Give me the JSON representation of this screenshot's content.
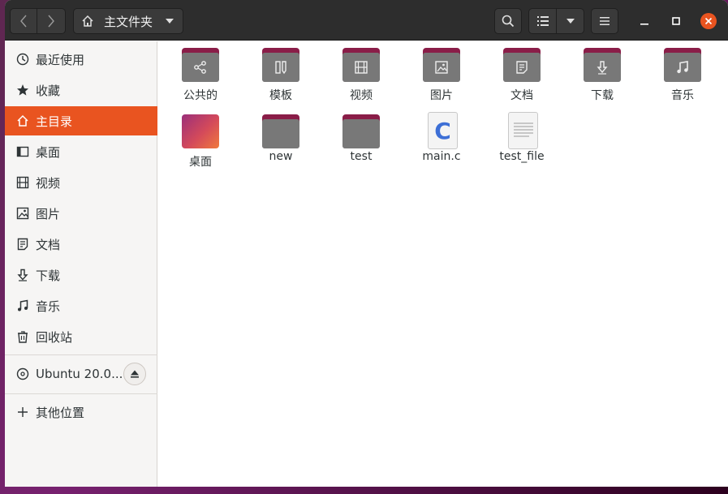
{
  "header": {
    "path_label": "主文件夹"
  },
  "sidebar": {
    "items": [
      {
        "label": "最近使用",
        "icon": "clock-icon"
      },
      {
        "label": "收藏",
        "icon": "star-icon"
      },
      {
        "label": "主目录",
        "icon": "home-icon",
        "active": true
      },
      {
        "label": "桌面",
        "icon": "desktop-icon"
      },
      {
        "label": "视频",
        "icon": "video-icon"
      },
      {
        "label": "图片",
        "icon": "picture-icon"
      },
      {
        "label": "文档",
        "icon": "document-icon"
      },
      {
        "label": "下载",
        "icon": "download-icon"
      },
      {
        "label": "音乐",
        "icon": "music-icon"
      },
      {
        "label": "回收站",
        "icon": "trash-icon"
      }
    ],
    "device": {
      "label": "Ubuntu 20.0...",
      "icon": "disc-icon"
    },
    "other": {
      "label": "其他位置",
      "icon": "plus-icon"
    }
  },
  "files": [
    {
      "label": "公共的",
      "kind": "folder",
      "icon": "share-icon"
    },
    {
      "label": "模板",
      "kind": "folder",
      "icon": "template-icon"
    },
    {
      "label": "视频",
      "kind": "folder",
      "icon": "video-icon"
    },
    {
      "label": "图片",
      "kind": "folder",
      "icon": "picture-icon"
    },
    {
      "label": "文档",
      "kind": "folder",
      "icon": "document-icon"
    },
    {
      "label": "下载",
      "kind": "folder",
      "icon": "download-icon"
    },
    {
      "label": "音乐",
      "kind": "folder",
      "icon": "music-icon"
    },
    {
      "label": "桌面",
      "kind": "desktop",
      "icon": "desktop-folder-icon"
    },
    {
      "label": "new",
      "kind": "folder-plain",
      "icon": "folder-icon"
    },
    {
      "label": "test",
      "kind": "folder-plain",
      "icon": "folder-icon"
    },
    {
      "label": "main.c",
      "kind": "c-file",
      "icon": "c-source-icon",
      "glyph": "C"
    },
    {
      "label": "test_file",
      "kind": "text-file",
      "icon": "text-file-icon"
    }
  ],
  "colors": {
    "accent": "#e95420",
    "headerbar": "#2d2d2d",
    "folder_tab": "#8a1d48",
    "folder_body": "#787878"
  }
}
